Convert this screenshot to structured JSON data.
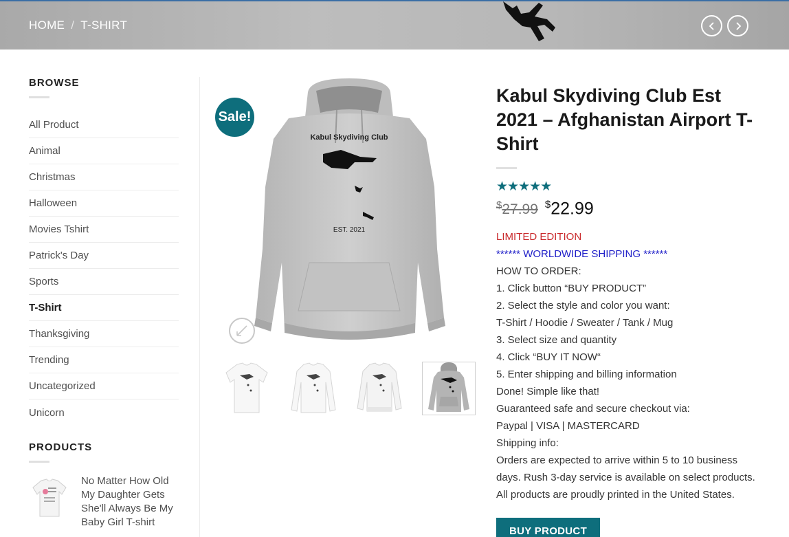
{
  "breadcrumb": {
    "home": "HOME",
    "separator": "/",
    "current": "T-SHIRT"
  },
  "header_nav": {
    "prev_icon": "chevron-left-icon",
    "next_icon": "chevron-right-icon"
  },
  "sidebar": {
    "browse_title": "BROWSE",
    "categories": [
      "All Product",
      "Animal",
      "Christmas",
      "Halloween",
      "Movies Tshirt",
      "Patrick's Day",
      "Sports",
      "T-Shirt",
      "Thanksgiving",
      "Trending",
      "Uncategorized",
      "Unicorn"
    ],
    "active_category": "T-Shirt",
    "products_title": "PRODUCTS",
    "products": [
      {
        "name": "No Matter How Old My Daughter Gets She'll Always Be My Baby Girl T-shirt"
      }
    ]
  },
  "gallery": {
    "sale_badge": "Sale!",
    "print_title": "Kabul Skydiving Club",
    "print_subtitle": "EST. 2021",
    "zoom_icon": "expand-icon",
    "thumbnails": [
      "white t-shirt",
      "white long sleeve",
      "white sweater",
      "grey hoodie"
    ],
    "active_thumbnail": 3
  },
  "product": {
    "title": "Kabul Skydiving Club Est 2021 – Afghanistan Airport T-Shirt",
    "rating": 5,
    "stars": "★★★★★",
    "currency": "$",
    "old_price": "27.99",
    "new_price": "22.99",
    "limited": "LIMITED EDITION",
    "shipping": "****** WORLDWIDE SHIPPING ******",
    "description": [
      "HOW TO ORDER:",
      "1. Click button “BUY PRODUCT”",
      "2. Select the style and color you want:",
      "T-Shirt / Hoodie / Sweater / Tank / Mug",
      "3. Select size and quantity",
      "4. Click “BUY IT NOW“",
      "5. Enter shipping and billing information",
      "Done! Simple like that!",
      "Guaranteed safe and secure checkout via:",
      "Paypal | VISA | MASTERCARD",
      "Shipping info:",
      "Orders are expected to arrive within 5 to 10 business days. Rush 3-day service is available on select products. All products are proudly printed in the United States."
    ],
    "buy_button": "BUY PRODUCT"
  },
  "colors": {
    "accent": "#0e6e7c",
    "limited": "#c9292b",
    "shipping": "#1e1ec8"
  }
}
